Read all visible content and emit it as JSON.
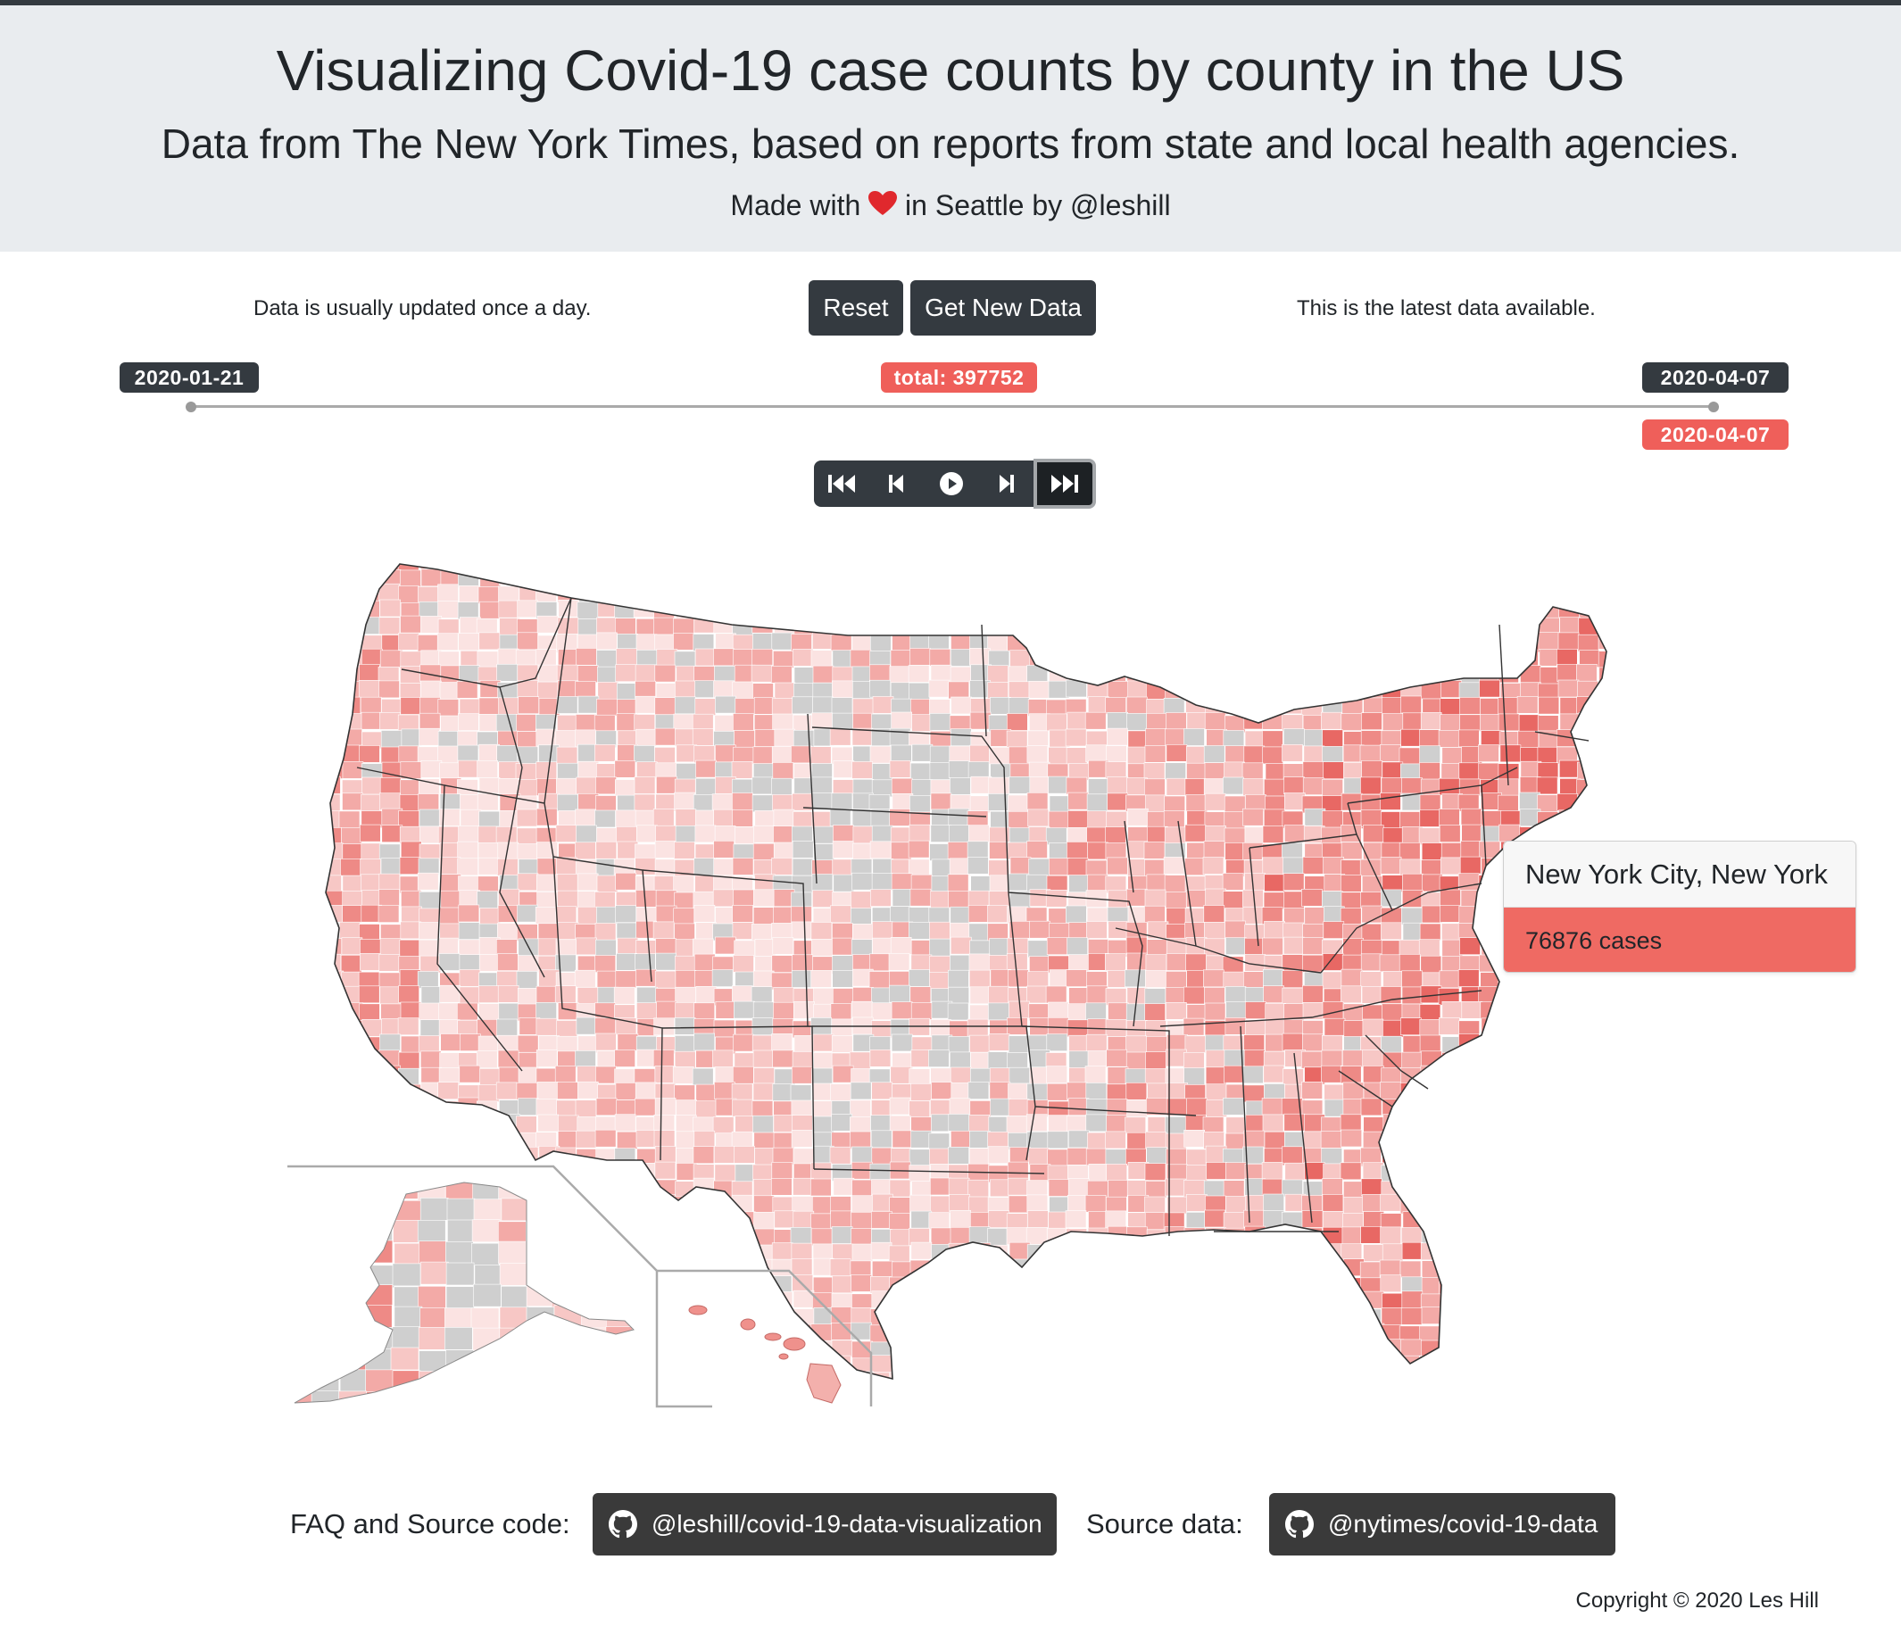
{
  "header": {
    "title": "Visualizing Covid-19 case counts by county in the US",
    "subtitle": "Data from The New York Times, based on reports from state and local health agencies.",
    "made_prefix": "Made with",
    "made_suffix": "in Seattle by @leshill"
  },
  "controls": {
    "update_note": "Data is usually updated once a day.",
    "reset_label": "Reset",
    "get_new_data_label": "Get New Data",
    "latest_note": "This is the latest data available."
  },
  "slider": {
    "start_date": "2020-01-21",
    "end_date": "2020-04-07",
    "total_label": "total: 397752",
    "current_date": "2020-04-07",
    "position_fraction": 1.0
  },
  "player": {
    "buttons": [
      "skip-to-start-icon",
      "step-back-icon",
      "play-icon",
      "step-forward-icon",
      "skip-to-end-icon"
    ],
    "active": "skip-to-end-icon"
  },
  "tooltip": {
    "location": "New York City, New York",
    "cases": "76876 cases"
  },
  "footer": {
    "faq_label": "FAQ and Source code:",
    "repo_label": "@leshill/covid-19-data-visualization",
    "source_label": "Source data:",
    "data_repo_label": "@nytimes/covid-19-data",
    "copyright": "Copyright © 2020 Les Hill"
  },
  "colors": {
    "dark": "#343a40",
    "accent_red": "#ef5f5a",
    "no_data_gray": "#cfcfcf",
    "case_scale": [
      "#fbe3e2",
      "#f7c7c5",
      "#f3aaa7",
      "#ee8a86",
      "#e86864"
    ]
  }
}
